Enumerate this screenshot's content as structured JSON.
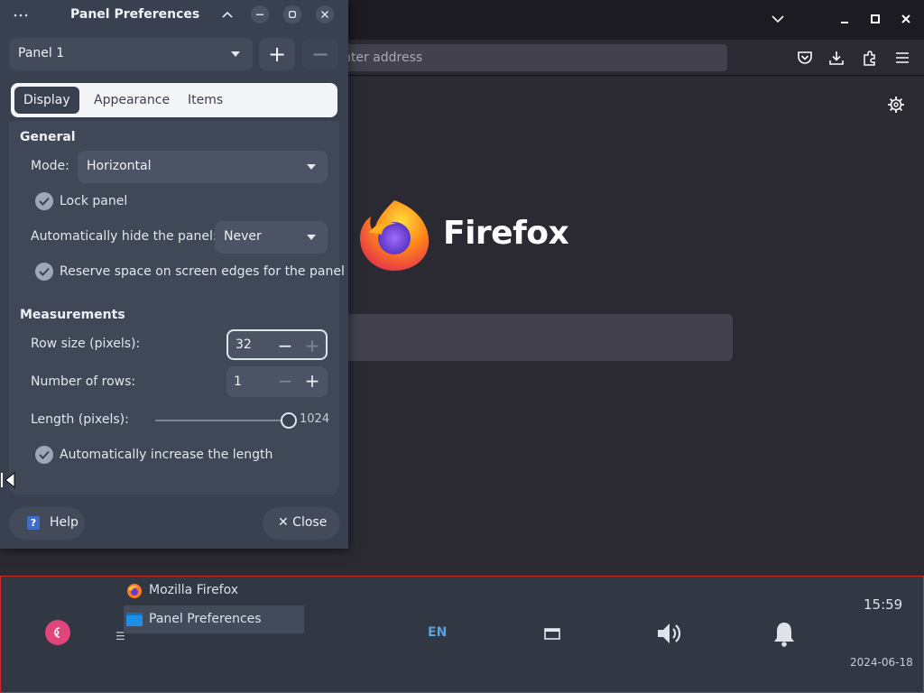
{
  "colors": {
    "desktop_bg": "#2b2a33",
    "dialog_bg": "#394150",
    "accent_blue": "#57a3e0",
    "debian_pink": "#e0457b",
    "taskbar_border": "#d02a2a"
  },
  "firefox": {
    "url_placeholder": "nter address",
    "wordmark": "Firefox",
    "window_controls": [
      "chevron-down-icon",
      "minimize-icon",
      "maximize-icon",
      "close-icon"
    ],
    "toolbar_icons": [
      "pocket-icon",
      "download-icon",
      "extensions-icon",
      "menu-icon"
    ]
  },
  "dialog": {
    "title": "Panel Preferences",
    "panel_select": "Panel 1",
    "add_symbol": "+",
    "remove_symbol": "−",
    "tabs": [
      {
        "label": "Display"
      },
      {
        "label": "Appearance"
      },
      {
        "label": "Items"
      }
    ],
    "general": {
      "title": "General",
      "mode_label": "Mode:",
      "mode_value": "Horizontal",
      "lock_panel": "Lock panel",
      "autohide_label": "Automatically hide the panel:",
      "autohide_value": "Never",
      "reserve_space": "Reserve space on screen edges for the panel"
    },
    "measurements": {
      "title": "Measurements",
      "row_size_label": "Row size (pixels):",
      "row_size_value": "32",
      "rows_label": "Number of rows:",
      "rows_value": "1",
      "length_label": "Length (pixels):",
      "length_value": "1024",
      "auto_length": "Automatically increase the length"
    },
    "help_label": "Help",
    "help_glyph": "?",
    "close_label": "✕ Close"
  },
  "taskbar": {
    "tasks": [
      {
        "label": "Mozilla Firefox",
        "icon": "firefox-icon"
      },
      {
        "label": "Panel Preferences",
        "icon": "window-icon"
      }
    ],
    "language": "EN",
    "time": "15:59",
    "date": "2024-06-18"
  }
}
